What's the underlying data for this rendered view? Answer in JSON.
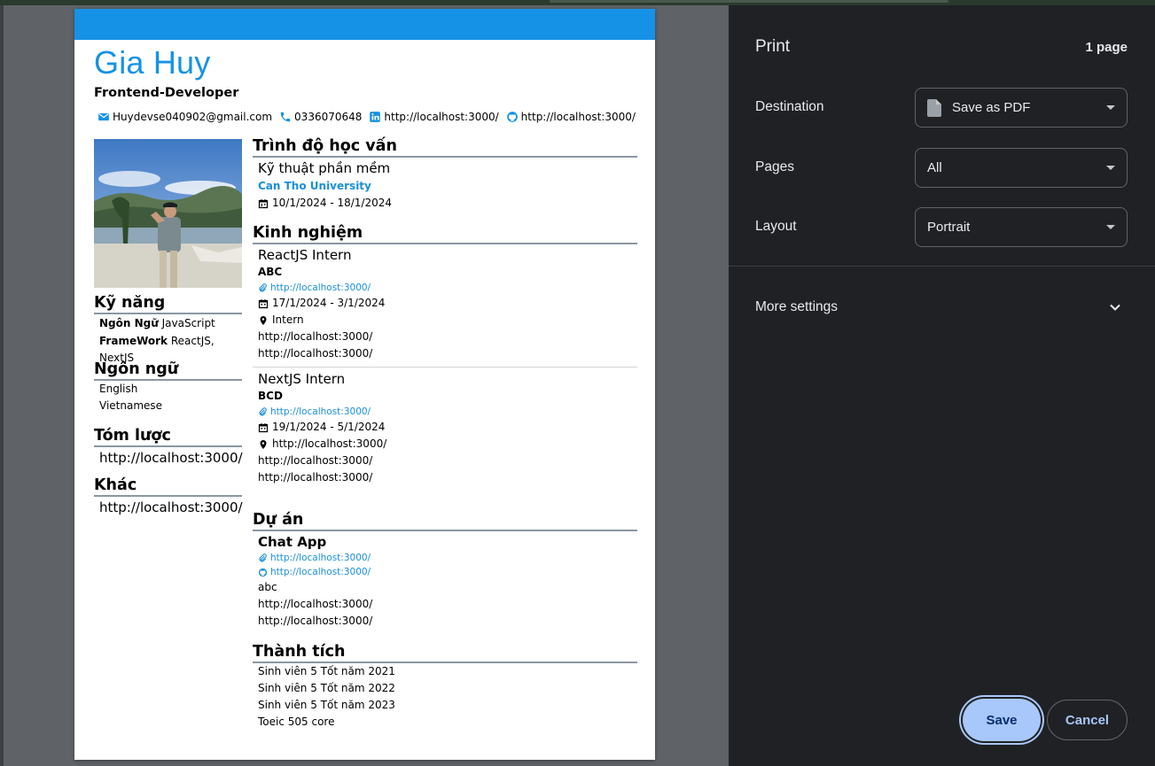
{
  "colors": {
    "accent": "#1592e6",
    "panel_bg": "#202124",
    "save_bg": "#a8c7fa"
  },
  "resume": {
    "name": "Gia Huy",
    "role": "Frontend-Developer",
    "contacts": {
      "email": "Huydevse040902@gmail.com",
      "phone": "0336070648",
      "linkedin": "http://localhost:3000/",
      "github": "http://localhost:3000/"
    },
    "skills": {
      "title": "Kỹ năng",
      "items": [
        {
          "label": "Ngôn Ngữ",
          "value": "JavaScript"
        },
        {
          "label": "FrameWork",
          "value": "ReactJS, NextJS"
        }
      ]
    },
    "languages": {
      "title": "Ngôn ngữ",
      "items": [
        "English",
        "Vietnamese"
      ]
    },
    "summary": {
      "title": "Tóm lược",
      "text": "http://localhost:3000/"
    },
    "other": {
      "title": "Khác",
      "text": "http://localhost:3000/"
    },
    "education": {
      "title": "Trình độ học vấn",
      "major": "Kỹ thuật phần mềm",
      "school": "Can Tho University",
      "dates": "10/1/2024 - 18/1/2024"
    },
    "experience": {
      "title": "Kinh nghiệm",
      "items": [
        {
          "position": "ReactJS Intern",
          "company": "ABC",
          "link": "http://localhost:3000/",
          "dates": "17/1/2024 - 3/1/2024",
          "location": "Intern",
          "line1": "http://localhost:3000/",
          "line2": "http://localhost:3000/"
        },
        {
          "position": "NextJS Intern",
          "company": "BCD",
          "link": "http://localhost:3000/",
          "dates": "19/1/2024 - 5/1/2024",
          "location": "http://localhost:3000/",
          "line1": "http://localhost:3000/",
          "line2": "http://localhost:3000/"
        }
      ]
    },
    "projects": {
      "title": "Dự án",
      "items": [
        {
          "name": "Chat App",
          "link": "http://localhost:3000/",
          "github": "http://localhost:3000/",
          "desc": "abc",
          "line1": "http://localhost:3000/",
          "line2": "http://localhost:3000/"
        }
      ]
    },
    "achievements": {
      "title": "Thành tích",
      "items": [
        "Sinh viên 5 Tốt năm 2021",
        "Sinh viên 5 Tốt năm 2022",
        "Sinh viên 5 Tốt năm 2023",
        "Toeic 505 core"
      ]
    }
  },
  "print_panel": {
    "title": "Print",
    "page_count": "1 page",
    "destination": {
      "label": "Destination",
      "value": "Save as PDF"
    },
    "pages": {
      "label": "Pages",
      "value": "All"
    },
    "layout": {
      "label": "Layout",
      "value": "Portrait"
    },
    "more_settings": "More settings",
    "save_label": "Save",
    "cancel_label": "Cancel"
  }
}
